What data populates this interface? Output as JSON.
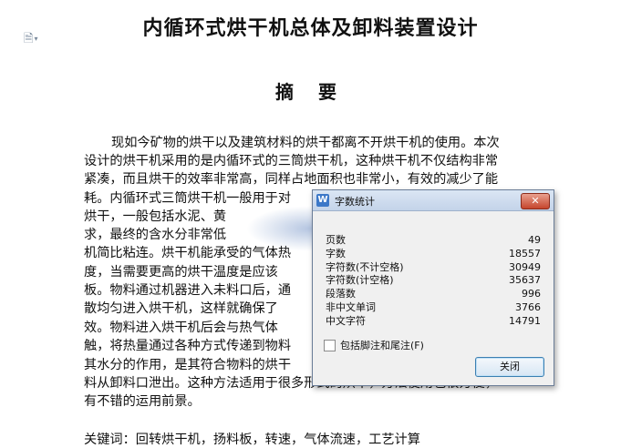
{
  "document": {
    "title": "内循环式烘干机总体及卸料装置设计",
    "abstract_heading": "摘 要",
    "lines": [
      "现如今矿物的烘干以及建筑材料的烘干都离不开烘干机的使用。本次",
      "设计的烘干机采用的是内循环式的三筒烘干机，这种烘干机不仅结构非常",
      "紧凑，而且烘干的效率非常高，同样占地面积也非常小，有效的减少了能",
      "耗。内循环式三筒烘干机一般用于对",
      "烘干，一般包括水泥、黄",
      "求，最终的含水分非常低",
      "机简比粘连。烘干机能承受的气体热",
      "度，当需要更高的烘干温度是应该",
      "板。物料通过机器进入未料口后，通",
      "散均匀进入烘干机，这样就确保了",
      "效。物料进入烘干机后会与热气体",
      "触，将热量通过各种方式传递到物料",
      "其水分的作用，是其符合物料的烘干",
      "料从卸料口泄出。这种方法适用于很多形式的烘干，方法使用也很方便，",
      "有不错的运用前景。"
    ],
    "keywords": "关键词：回转烘干机，扬料板，转速，气体流速，工艺计算"
  },
  "dialog": {
    "title": "字数统计",
    "close_glyph": "✕",
    "app_icon": "W",
    "stats": [
      {
        "label": "页数",
        "value": "49"
      },
      {
        "label": "字数",
        "value": "18557"
      },
      {
        "label": "字符数(不计空格)",
        "value": "30949"
      },
      {
        "label": "字符数(计空格)",
        "value": "35637"
      },
      {
        "label": "段落数",
        "value": "996"
      },
      {
        "label": "非中文单词",
        "value": "3766"
      },
      {
        "label": "中文字符",
        "value": "14791"
      }
    ],
    "checkbox_label": "包括脚注和尾注(F)",
    "close_button": "关闭"
  }
}
